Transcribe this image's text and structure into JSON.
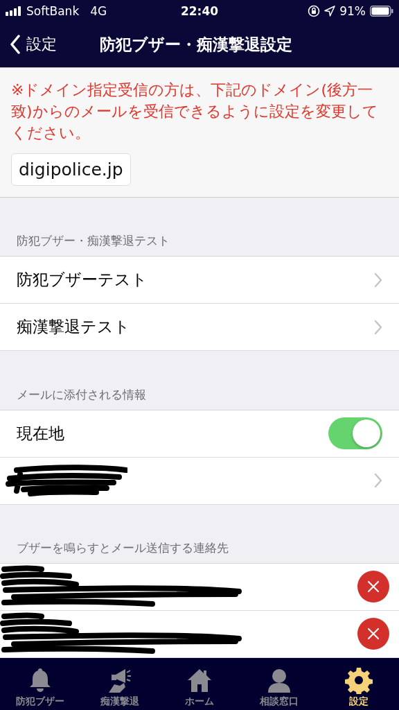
{
  "status_bar": {
    "carrier": "SoftBank",
    "network": "4G",
    "time": "22:40",
    "battery": "91%"
  },
  "nav": {
    "back": "設定",
    "title": "防犯ブザー・痴漢撃退設定"
  },
  "notice": {
    "text": "※ドメイン指定受信の方は、下記のドメイン(後方一致)からのメールを受信できるように設定を変更してください。",
    "domain": "digipolice.jp"
  },
  "sections": [
    {
      "header": "防犯ブザー・痴漢撃退テスト",
      "rows": [
        {
          "kind": "link",
          "label": "防犯ブザーテスト"
        },
        {
          "kind": "link",
          "label": "痴漢撃退テスト"
        }
      ]
    },
    {
      "header": "メールに添付される情報",
      "rows": [
        {
          "kind": "toggle",
          "label": "現在地",
          "on": true
        },
        {
          "kind": "redacted_link"
        }
      ]
    },
    {
      "header": "ブザーを鳴らすとメール送信する連絡先",
      "rows": [
        {
          "kind": "contact"
        },
        {
          "kind": "contact"
        }
      ]
    }
  ],
  "tabs": [
    {
      "label": "防犯ブザー",
      "selected": false
    },
    {
      "label": "痴漢撃退",
      "selected": false
    },
    {
      "label": "ホーム",
      "selected": false
    },
    {
      "label": "相談窓口",
      "selected": false
    },
    {
      "label": "設定",
      "selected": true
    }
  ]
}
